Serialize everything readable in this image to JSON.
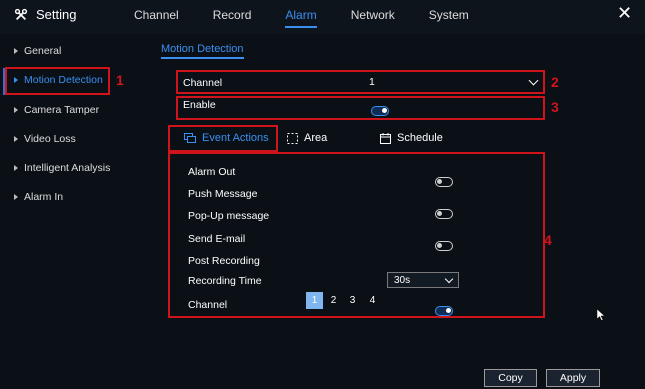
{
  "header": {
    "title": "Setting",
    "tabs": [
      "Channel",
      "Record",
      "Alarm",
      "Network",
      "System"
    ],
    "active_tab": "Alarm",
    "close_symbol": "✕"
  },
  "sidebar": {
    "items": [
      {
        "label": "General"
      },
      {
        "label": "Motion Detection"
      },
      {
        "label": "Camera Tamper"
      },
      {
        "label": "Video Loss"
      },
      {
        "label": "Intelligent Analysis"
      },
      {
        "label": "Alarm In"
      }
    ],
    "active": "Motion Detection"
  },
  "subtab": "Motion Detection",
  "channel": {
    "label": "Channel",
    "value": "1"
  },
  "enable": {
    "label": "Enable",
    "state": "on"
  },
  "content_tabs": [
    {
      "label": "Event Actions",
      "icon": "event-actions-icon"
    },
    {
      "label": "Area",
      "icon": "area-icon"
    },
    {
      "label": "Schedule",
      "icon": "calendar-icon"
    }
  ],
  "event_actions": {
    "rows": [
      {
        "label": "Alarm Out",
        "state": "off"
      },
      {
        "label": "Push Message",
        "state": "off"
      },
      {
        "label": "Pop-Up message",
        "state": "off"
      },
      {
        "label": "Send E-mail",
        "state": "off"
      },
      {
        "label": "Post Recording",
        "state": "on"
      }
    ],
    "recording_time": {
      "label": "Recording Time",
      "value": "30s"
    },
    "channel_label": "Channel",
    "channels": [
      "1",
      "2",
      "3",
      "4"
    ],
    "selected_channel": "1"
  },
  "annotations": [
    "1",
    "2",
    "3",
    "4"
  ],
  "buttons": {
    "copy": "Copy",
    "apply": "Apply"
  },
  "colors": {
    "accent": "#3a8ff0",
    "annotation": "#d0141b",
    "background": "#0b1016"
  }
}
